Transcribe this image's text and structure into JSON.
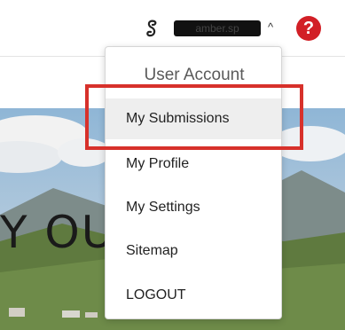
{
  "header": {
    "user_logo_icon": "user-logo-icon",
    "username": "amber.sp",
    "caret": "^",
    "help_label": "?"
  },
  "hero": {
    "text": "Y OU"
  },
  "dropdown": {
    "title": "User Account",
    "items": [
      {
        "label": "My Submissions"
      },
      {
        "label": "My Profile"
      },
      {
        "label": "My Settings"
      },
      {
        "label": "Sitemap"
      },
      {
        "label": "LOGOUT"
      }
    ]
  },
  "colors": {
    "highlight": "#d7312b",
    "help": "#d21f26",
    "hover": "#eeeeee"
  }
}
